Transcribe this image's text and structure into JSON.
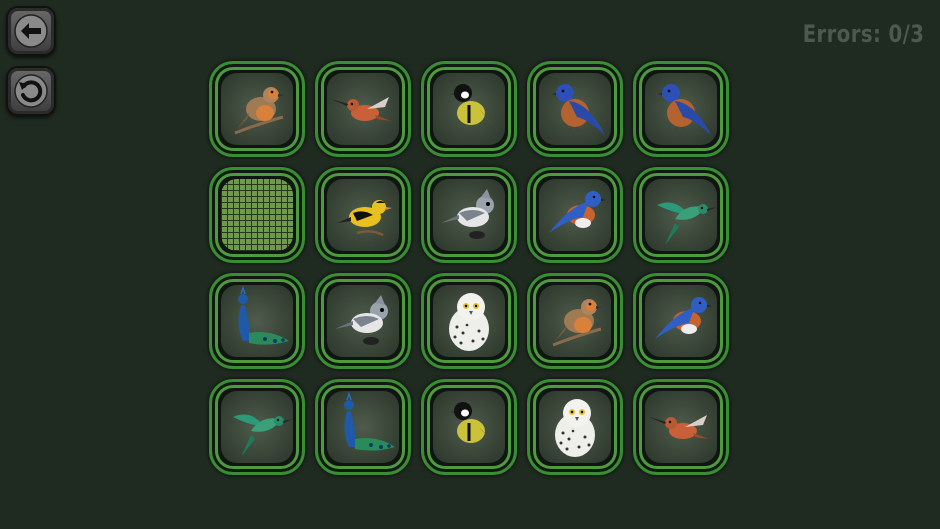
{
  "hud": {
    "errors_text": "Errors: 0/3"
  },
  "buttons": {
    "back_icon": "arrow-left-icon",
    "undo_icon": "undo-icon"
  },
  "board": {
    "rows": 4,
    "cols": 5,
    "cards": [
      {
        "bird": "robin",
        "state": "revealed"
      },
      {
        "bird": "rufous-hummingbird",
        "state": "revealed"
      },
      {
        "bird": "great-tit",
        "state": "revealed"
      },
      {
        "bird": "western-bluebird",
        "state": "revealed"
      },
      {
        "bird": "western-bluebird",
        "state": "revealed"
      },
      {
        "bird": "",
        "state": "hidden"
      },
      {
        "bird": "goldfinch",
        "state": "revealed"
      },
      {
        "bird": "tufted-titmouse",
        "state": "revealed"
      },
      {
        "bird": "eastern-bluebird",
        "state": "revealed"
      },
      {
        "bird": "green-hummingbird",
        "state": "revealed"
      },
      {
        "bird": "peacock",
        "state": "revealed"
      },
      {
        "bird": "tufted-titmouse",
        "state": "revealed"
      },
      {
        "bird": "snowy-owl",
        "state": "revealed"
      },
      {
        "bird": "robin",
        "state": "revealed"
      },
      {
        "bird": "eastern-bluebird",
        "state": "revealed"
      },
      {
        "bird": "green-hummingbird",
        "state": "revealed"
      },
      {
        "bird": "peacock",
        "state": "revealed"
      },
      {
        "bird": "great-tit",
        "state": "revealed"
      },
      {
        "bird": "snowy-owl",
        "state": "revealed"
      },
      {
        "bird": "rufous-hummingbird",
        "state": "revealed"
      }
    ]
  }
}
